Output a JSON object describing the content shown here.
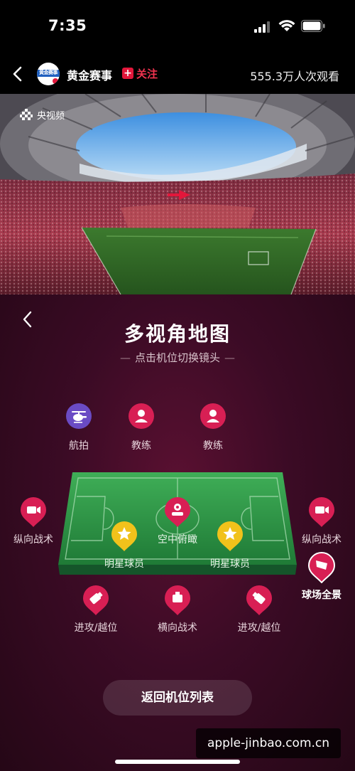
{
  "status_bar": {
    "time": "7:35"
  },
  "header": {
    "channel_name": "黄金赛事",
    "avatar_text": "黄金赛事",
    "follow_label": "关注",
    "view_count": "555.3万人次观看"
  },
  "video": {
    "logo_text": "央视频"
  },
  "panel": {
    "title": "多视角地图",
    "subtitle": "点击机位切换镜头",
    "cameras": [
      {
        "label": "航拍",
        "icon": "helicopter-icon",
        "color": "#6a4bc4"
      },
      {
        "label": "教练",
        "icon": "person-icon",
        "color": "#d81f54"
      },
      {
        "label": "教练",
        "icon": "person-icon",
        "color": "#d81f54"
      },
      {
        "label": "纵向战术",
        "icon": "video-camera-icon",
        "color": "#d81f54"
      },
      {
        "label": "空中俯瞰",
        "icon": "drone-icon",
        "color": "#d81f54"
      },
      {
        "label": "纵向战术",
        "icon": "video-camera-icon",
        "color": "#d81f54"
      },
      {
        "label": "明星球员",
        "icon": "star-icon",
        "color": "#f1c21b"
      },
      {
        "label": "明星球员",
        "icon": "star-icon",
        "color": "#f1c21b"
      },
      {
        "label": "球场全景",
        "icon": "flag-icon",
        "color": "#d81f54"
      },
      {
        "label": "进攻/越位",
        "icon": "camera-icon",
        "color": "#d81f54"
      },
      {
        "label": "横向战术",
        "icon": "camera-icon",
        "color": "#d81f54"
      },
      {
        "label": "进攻/越位",
        "icon": "camera-icon",
        "color": "#d81f54"
      }
    ],
    "return_button": "返回机位列表"
  },
  "watermark": "apple-jinbao.com.cn",
  "colors": {
    "accent": "#d81f54",
    "star": "#f1c21b",
    "aerial": "#6a4bc4",
    "pitch": "#2f9a4a"
  }
}
